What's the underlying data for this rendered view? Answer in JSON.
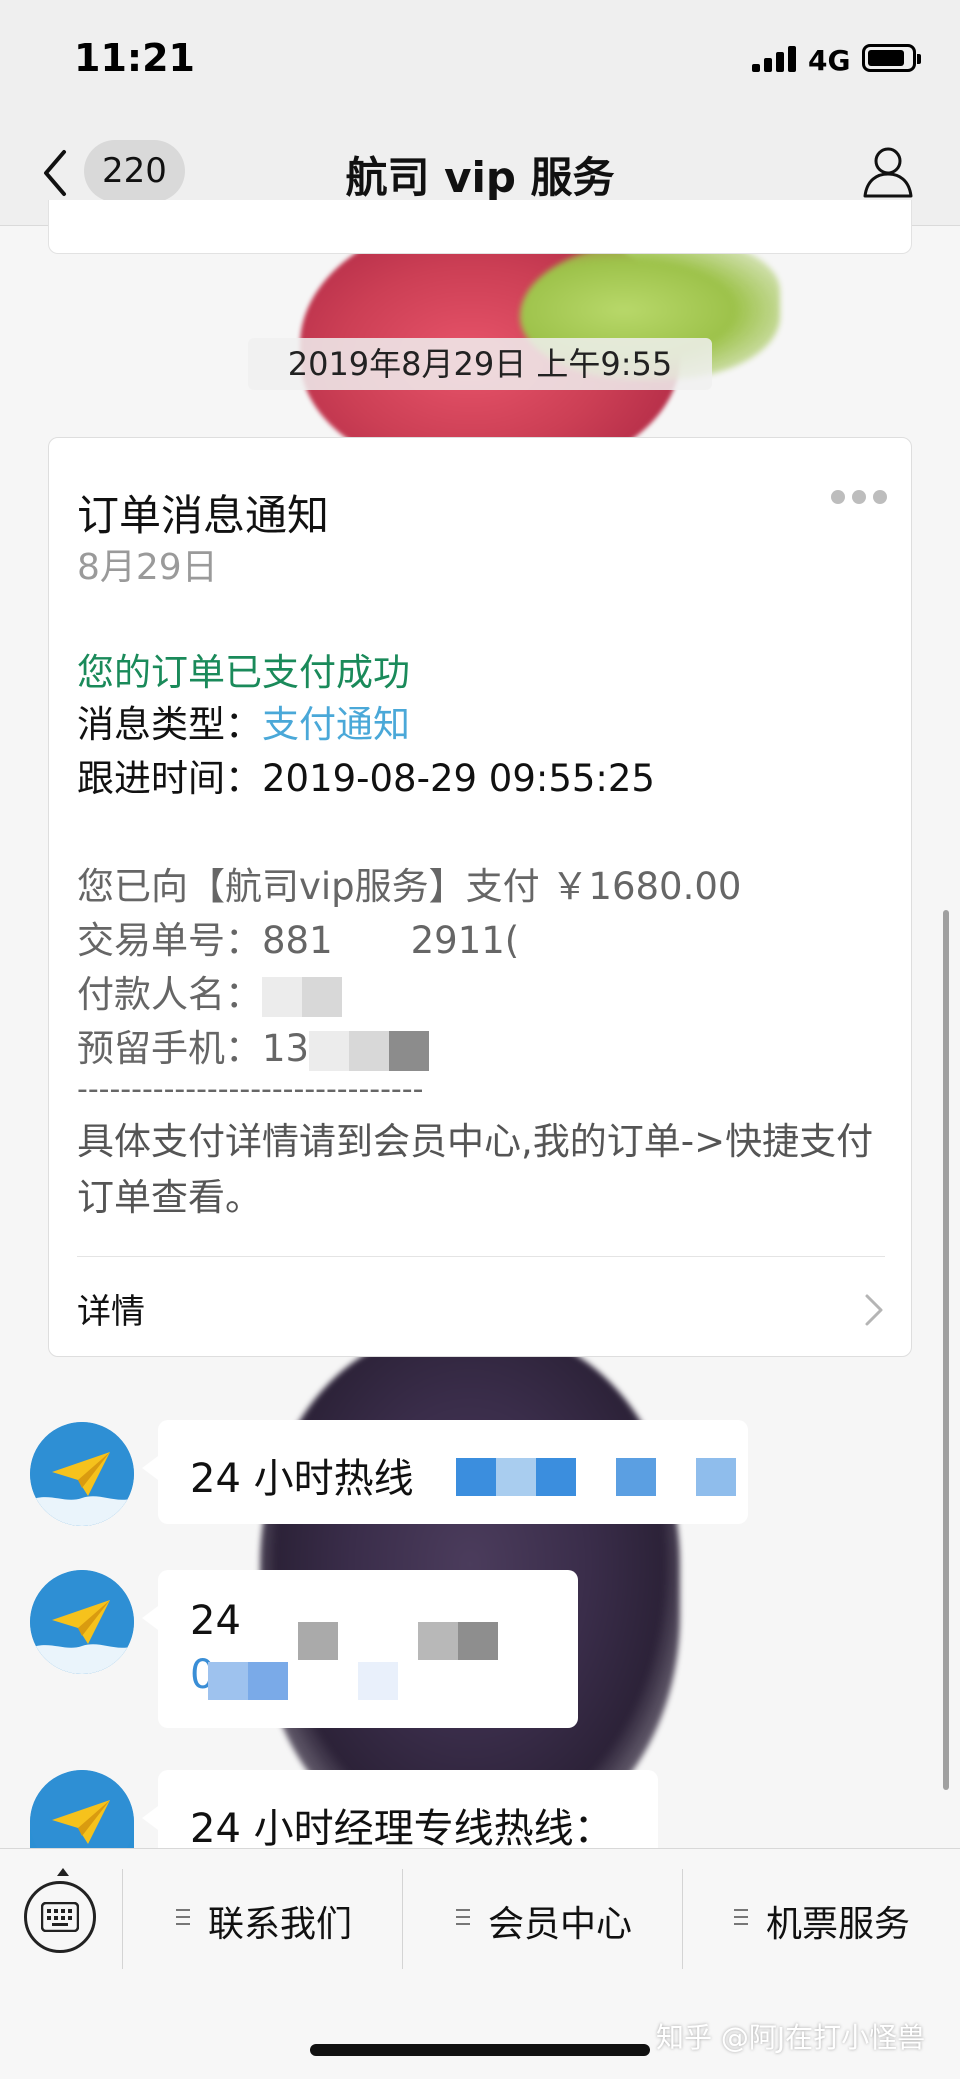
{
  "status_bar": {
    "time": "11:21",
    "network": "4G",
    "icons": [
      "signal-icon",
      "battery-icon"
    ]
  },
  "nav": {
    "back_icon": "chevron-left-icon",
    "unread_count": "220",
    "title": "航司 vip 服务",
    "profile_icon": "person-icon"
  },
  "timestamp": "2019年8月29日 上午9:55",
  "order_card": {
    "title": "订单消息通知",
    "date": "8月29日",
    "status": "您的订单已支付成功",
    "type_label": "消息类型：",
    "type_value": "支付通知",
    "time_label": "跟进时间：",
    "time_value": "2019-08-29 09:55:25",
    "payment_line": "您已向【航司vip服务】支付 ￥1680.00",
    "order_no_label": "交易单号：",
    "order_no_part1": "881",
    "order_no_part2": "2911(",
    "payer_label": "付款人名：",
    "phone_label": "预留手机：",
    "phone_partial": "13",
    "separator": "--------------------------------",
    "help_text": "具体支付详情请到会员中心,我的订单->快捷支付订单查看。",
    "details_label": "详情",
    "colors": {
      "success": "#1a8a5a",
      "link": "#4aa8d8"
    }
  },
  "messages": [
    {
      "text": "24 小时热线"
    },
    {
      "text_line1": "24",
      "text_line2": "0"
    },
    {
      "text": "24 小时经理专线热线："
    }
  ],
  "bottom_menu": {
    "keyboard_icon": "keyboard-icon",
    "items": [
      {
        "label": "联系我们"
      },
      {
        "label": "会员中心"
      },
      {
        "label": "机票服务"
      }
    ]
  },
  "watermark": "知乎 @阿J在打小怪兽"
}
